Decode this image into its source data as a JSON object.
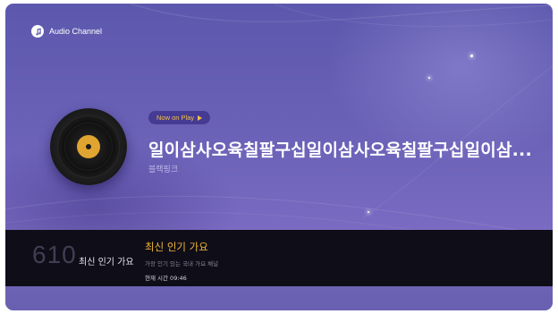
{
  "app": {
    "title": "Audio Channel",
    "icon": "music-note-icon"
  },
  "now_playing": {
    "badge_label": "Now on Play",
    "title": "일이삼사오육칠팔구십일이삼사오육칠팔구십일이삼...",
    "artist": "블랙핑크"
  },
  "channel": {
    "number": "610",
    "name": "최신 인기 가요",
    "program_title": "최신 인기 가요",
    "program_desc": "가장 인기 있는 국내 가요 채널",
    "current_time": "현재 시간 09:46"
  },
  "colors": {
    "accent": "#f1b637",
    "background_top": "#5c58ad",
    "background_bottom": "#7b6bc2",
    "info_bar": "#0e0d18",
    "record_label": "#e0a531"
  }
}
